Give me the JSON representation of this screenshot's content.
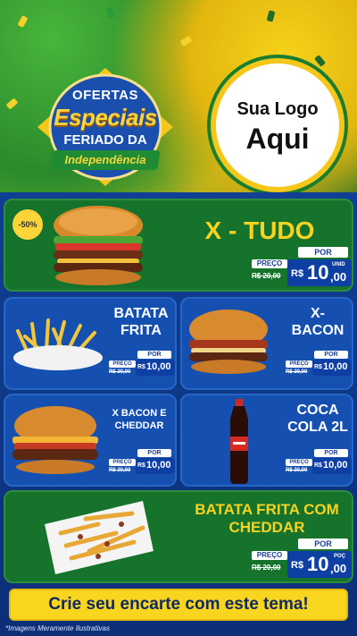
{
  "hero": {
    "badge_line1": "OFERTAS",
    "badge_line2": "Especiais",
    "badge_line3": "FERIADO DA",
    "badge_line4": "Independência",
    "logo_line1": "Sua Logo",
    "logo_line2": "Aqui"
  },
  "products": [
    {
      "name": "X - TUDO",
      "discount": "-50%",
      "por_label": "POR",
      "preco_label": "PREÇO",
      "old_price": "R$ 20,00",
      "currency": "R$",
      "price_int": "10",
      "price_dec": ",00",
      "unit": "UNID"
    },
    {
      "name_line1": "BATATA",
      "name_line2": "FRITA",
      "por_label": "POR",
      "preco_label": "PREÇO",
      "old_price": "R$ 20,00",
      "currency": "R$",
      "price": "10,00"
    },
    {
      "name_line1": "X-",
      "name_line2": "BACON",
      "por_label": "POR",
      "preco_label": "PREÇO",
      "old_price": "R$ 20,00",
      "currency": "R$",
      "price": "10,00"
    },
    {
      "name_line1": "X BACON E",
      "name_line2": "CHEDDAR",
      "por_label": "POR",
      "preco_label": "PREÇO",
      "old_price": "R$ 20,00",
      "currency": "R$",
      "price": "10,00"
    },
    {
      "name_line1": "COCA",
      "name_line2": "COLA 2L",
      "por_label": "POR",
      "preco_label": "PREÇO",
      "old_price": "R$ 20,00",
      "currency": "R$",
      "price": "10,00"
    },
    {
      "name_line1": "BATATA FRITA COM",
      "name_line2": "CHEDDAR",
      "por_label": "POR",
      "preco_label": "PREÇO",
      "old_price": "R$ 20,00",
      "currency": "R$",
      "price_int": "10",
      "price_dec": ",00",
      "unit": "POÇ"
    }
  ],
  "cta": "Crie seu encarte com este tema!",
  "footnote": "*Imagens Meramente Ilustrativas",
  "colors": {
    "green": "#15732b",
    "blue": "#1550b0",
    "yellow": "#f9d220",
    "navy": "#0e3fa3"
  }
}
